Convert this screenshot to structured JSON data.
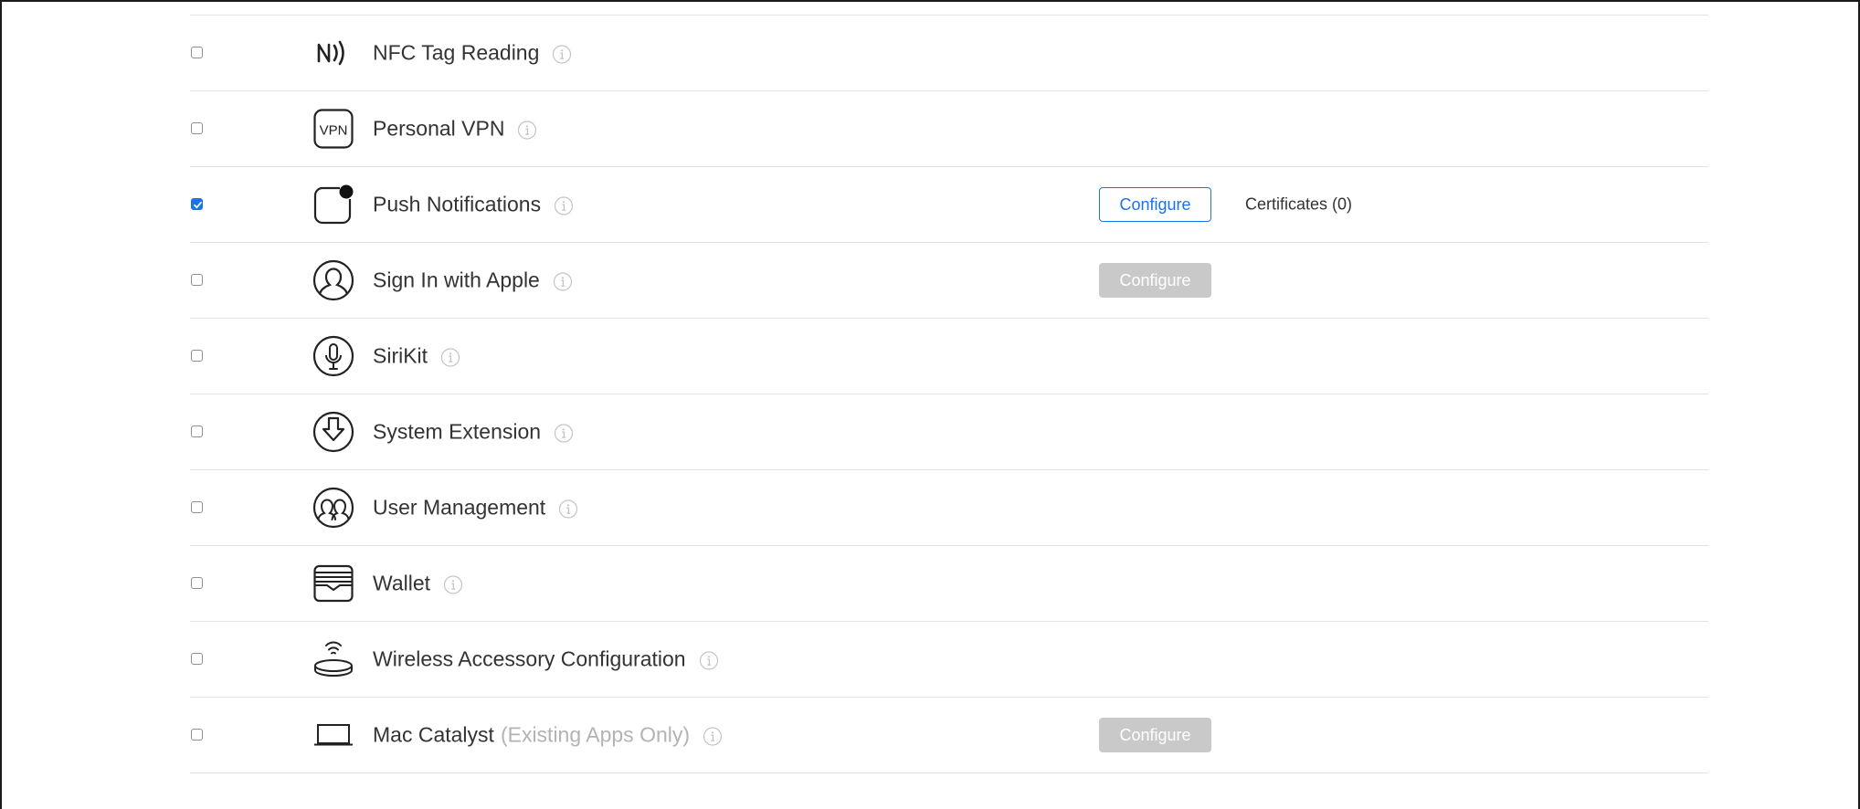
{
  "capabilities": [
    {
      "key": "nfc",
      "name": "NFC Tag Reading",
      "note": "",
      "icon": "nfc-icon",
      "checked": false,
      "button": null,
      "extra": ""
    },
    {
      "key": "vpn",
      "name": "Personal VPN",
      "note": "",
      "icon": "vpn-icon",
      "vpn_text": "VPN",
      "checked": false,
      "button": null,
      "extra": ""
    },
    {
      "key": "push",
      "name": "Push Notifications",
      "note": "",
      "icon": "push-notification-icon",
      "checked": true,
      "button": {
        "label": "Configure",
        "enabled": true
      },
      "extra": "Certificates (0)"
    },
    {
      "key": "siwa",
      "name": "Sign In with Apple",
      "note": "",
      "icon": "person-icon",
      "checked": false,
      "button": {
        "label": "Configure",
        "enabled": false
      },
      "extra": ""
    },
    {
      "key": "sirikit",
      "name": "SiriKit",
      "note": "",
      "icon": "microphone-icon",
      "checked": false,
      "button": null,
      "extra": ""
    },
    {
      "key": "sysext",
      "name": "System Extension",
      "note": "",
      "icon": "download-arrow-icon",
      "checked": false,
      "button": null,
      "extra": ""
    },
    {
      "key": "usermgmt",
      "name": "User Management",
      "note": "",
      "icon": "users-icon",
      "checked": false,
      "button": null,
      "extra": ""
    },
    {
      "key": "wallet",
      "name": "Wallet",
      "note": "",
      "icon": "wallet-icon",
      "checked": false,
      "button": null,
      "extra": ""
    },
    {
      "key": "wac",
      "name": "Wireless Accessory Configuration",
      "note": "",
      "icon": "wireless-accessory-icon",
      "checked": false,
      "button": null,
      "extra": ""
    },
    {
      "key": "catalyst",
      "name": "Mac Catalyst",
      "note": "(Existing Apps Only)",
      "icon": "laptop-icon",
      "checked": false,
      "button": {
        "label": "Configure",
        "enabled": false
      },
      "extra": ""
    }
  ],
  "colors": {
    "accent": "#1a73e8",
    "text": "#333333",
    "muted": "#b3b3b3",
    "disabled_button": "#c9c9c9",
    "divider": "#e3e3e3"
  }
}
